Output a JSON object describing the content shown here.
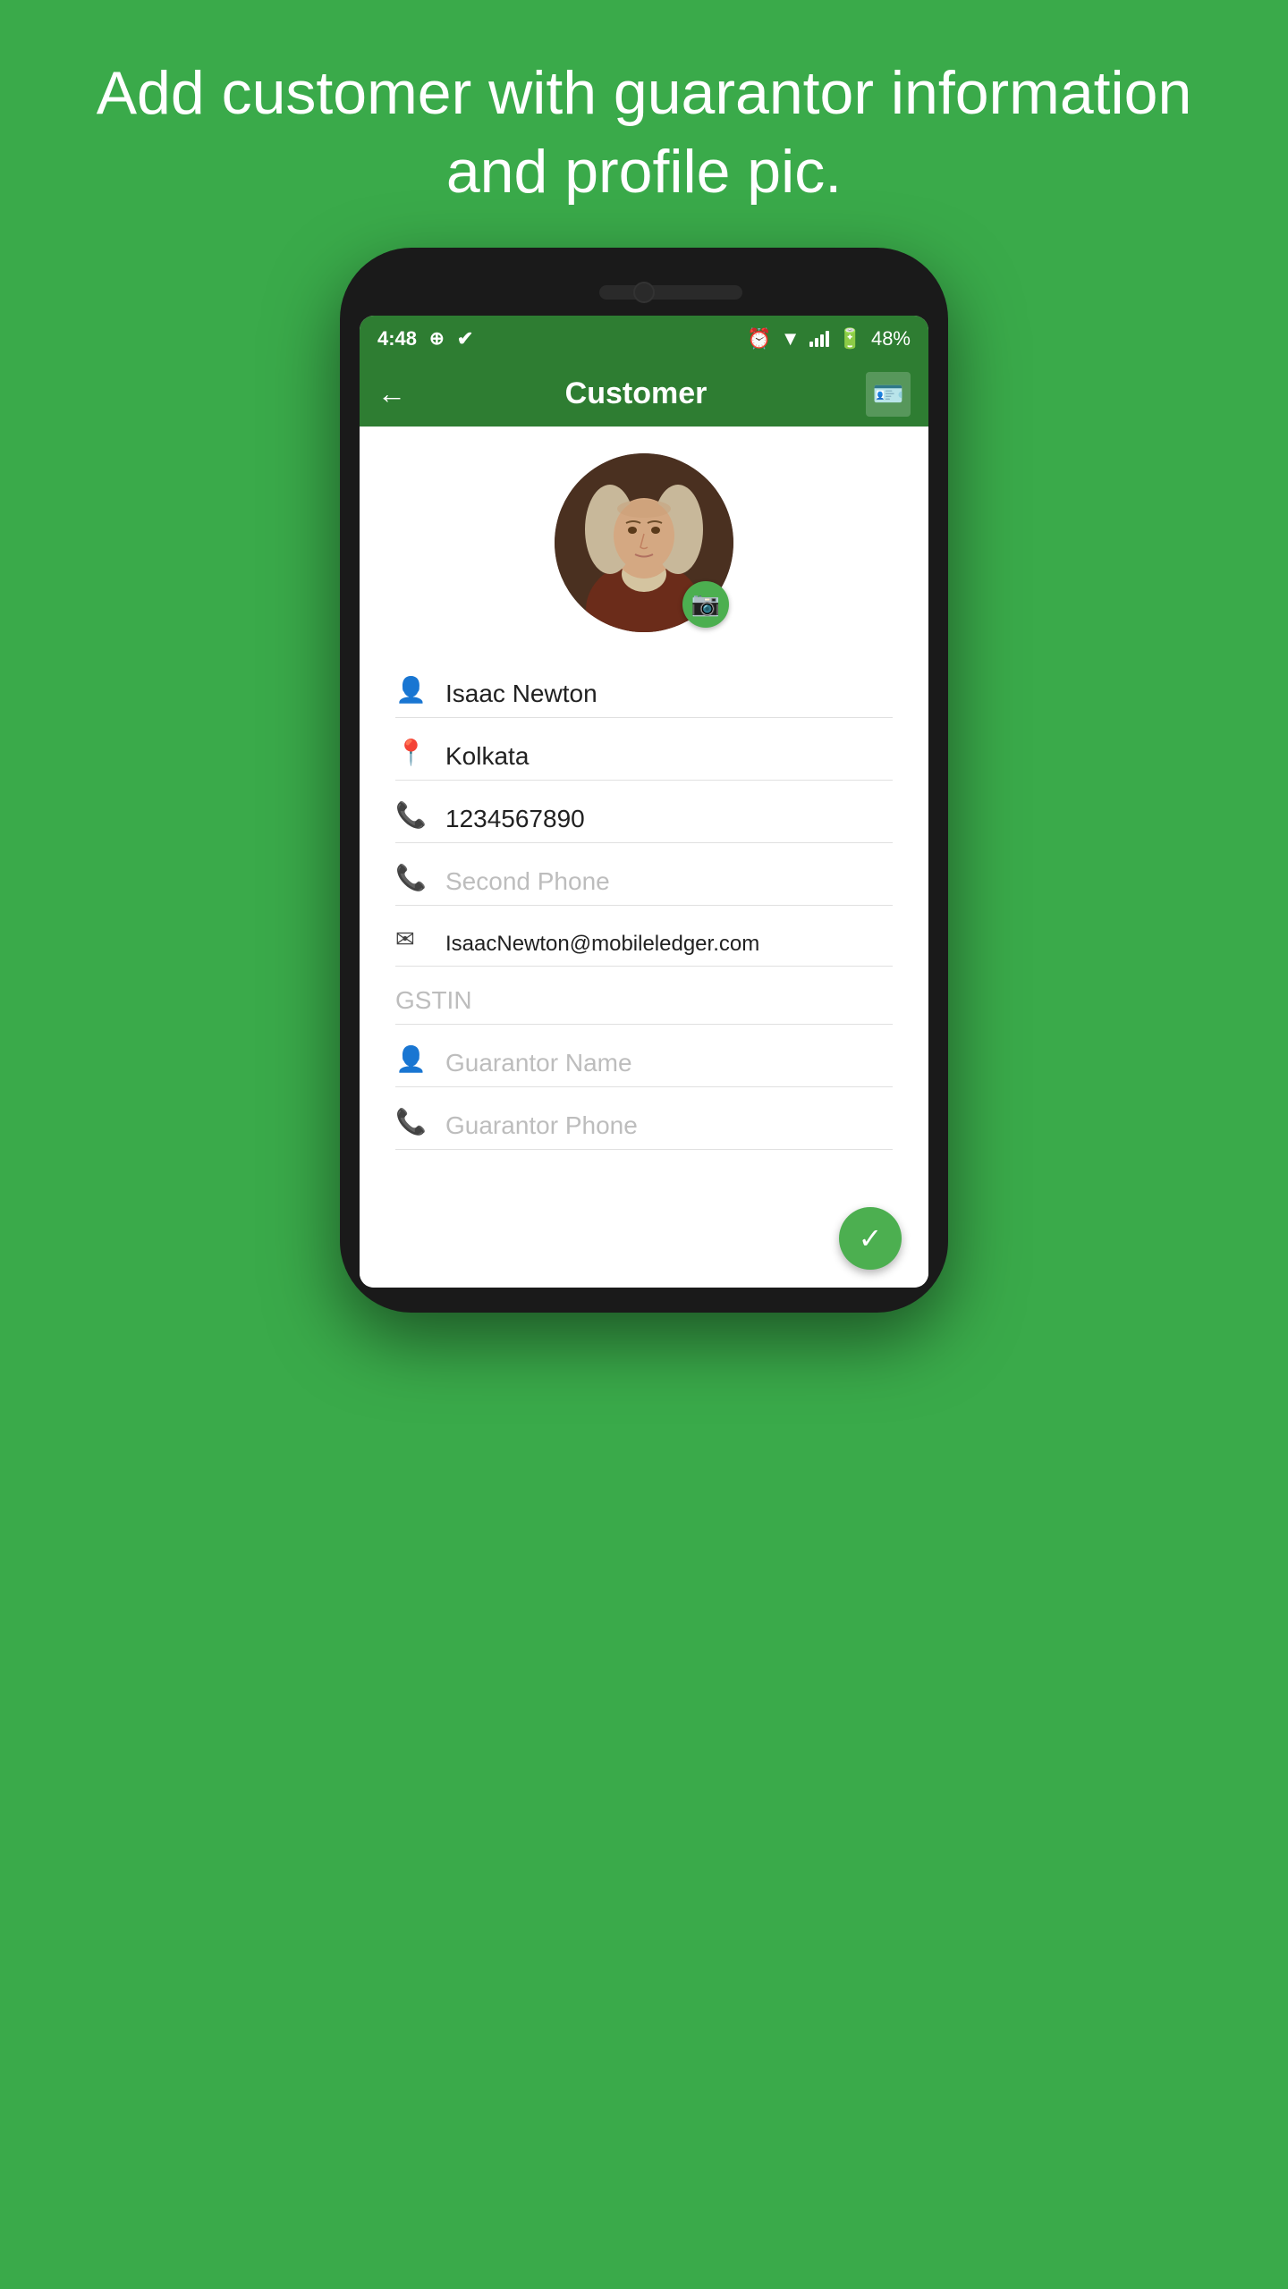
{
  "page": {
    "headline": "Add customer with guarantor information and profile pic.",
    "background_color": "#3aaa4a"
  },
  "status_bar": {
    "time": "4:48",
    "battery_percent": "48%",
    "icons": [
      "whatsapp",
      "double-check",
      "alarm",
      "wifi",
      "signal",
      "battery"
    ]
  },
  "app_bar": {
    "title": "Customer",
    "back_label": "←",
    "contact_icon_label": "contact-card"
  },
  "form": {
    "name_value": "Isaac Newton",
    "location_value": "Kolkata",
    "phone_value": "1234567890",
    "second_phone_placeholder": "Second Phone",
    "email_value": "IsaacNewton@mobileledger.com",
    "gstin_placeholder": "GSTIN",
    "guarantor_name_placeholder": "Guarantor Name",
    "guarantor_phone_placeholder": "Guarantor Phone"
  },
  "icons": {
    "person": "👤",
    "location": "📍",
    "phone": "📞",
    "email": "✉",
    "camera": "📷",
    "back_arrow": "←"
  }
}
